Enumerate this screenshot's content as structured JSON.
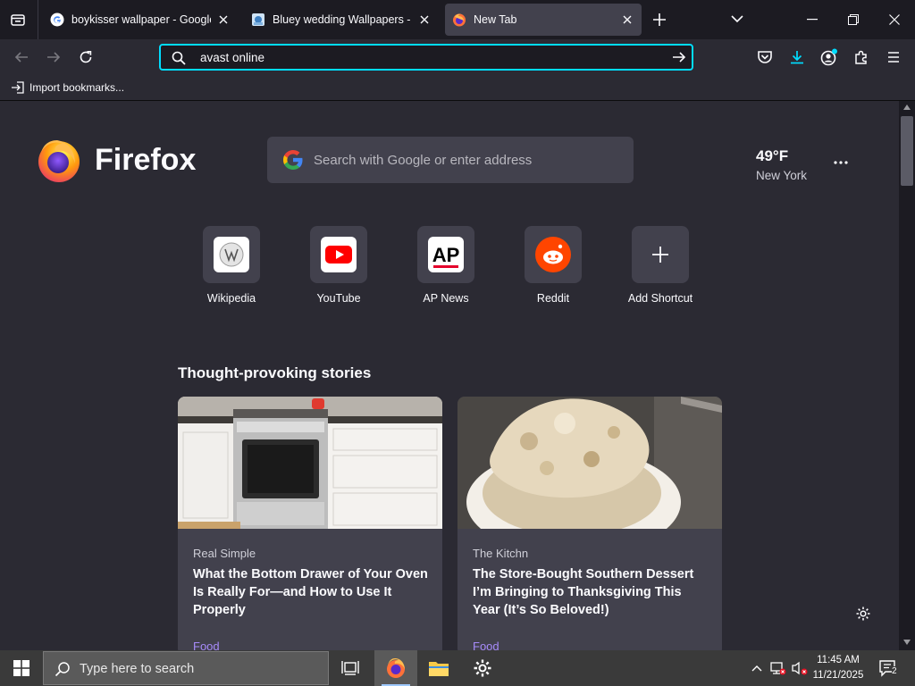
{
  "tabs": [
    {
      "title": "boykisser wallpaper - Google Se",
      "favicon": "google-favicon"
    },
    {
      "title": "Bluey wedding Wallpapers - Blu",
      "favicon": "bluey-favicon"
    },
    {
      "title": "New Tab",
      "favicon": "firefox-favicon",
      "active": true
    }
  ],
  "urlbar": {
    "value": "avast online"
  },
  "bookmarks": {
    "import_label": "Import bookmarks..."
  },
  "newtab": {
    "brand": "Firefox",
    "search_placeholder": "Search with Google or enter address",
    "weather": {
      "temp": "49°F",
      "city": "New York"
    },
    "shortcuts": [
      {
        "label": "Wikipedia",
        "icon": "wikipedia-icon"
      },
      {
        "label": "YouTube",
        "icon": "youtube-icon"
      },
      {
        "label": "AP News",
        "icon": "apnews-icon"
      },
      {
        "label": "Reddit",
        "icon": "reddit-icon"
      },
      {
        "label": "Add Shortcut",
        "icon": "plus-icon"
      }
    ],
    "stories_title": "Thought-provoking stories",
    "stories": [
      {
        "source": "Real Simple",
        "headline": "What the Bottom Drawer of Your Oven Is Really For—and How to Use It Properly",
        "category": "Food"
      },
      {
        "source": "The Kitchn",
        "headline": "The Store-Bought Southern Dessert I’m Bringing to Thanksgiving This Year (It’s So Beloved!)",
        "category": "Food"
      }
    ]
  },
  "taskbar": {
    "search_placeholder": "Type here to search",
    "time": "11:45 AM",
    "date": "11/21/2025",
    "notification_count": "2"
  },
  "colors": {
    "accent": "#00ddff",
    "category": "#a78bfa"
  }
}
